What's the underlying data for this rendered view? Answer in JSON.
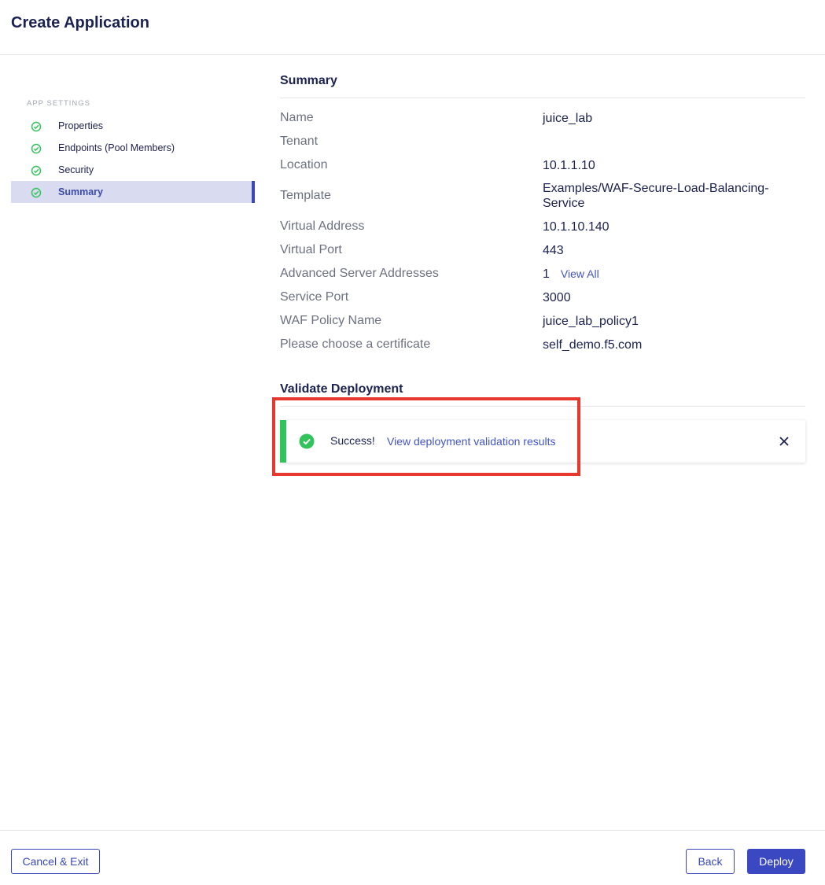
{
  "header": {
    "title": "Create Application"
  },
  "sidebar": {
    "section_label": "APP SETTINGS",
    "items": [
      {
        "label": "Properties",
        "status": "complete"
      },
      {
        "label": "Endpoints (Pool Members)",
        "status": "complete"
      },
      {
        "label": "Security",
        "status": "complete"
      },
      {
        "label": "Summary",
        "status": "complete",
        "active": true
      }
    ]
  },
  "summary": {
    "title": "Summary",
    "rows": [
      {
        "key": "Name",
        "value": "juice_lab"
      },
      {
        "key": "Tenant",
        "value": ""
      },
      {
        "key": "Location",
        "value": "10.1.1.10"
      },
      {
        "key": "Template",
        "value": "Examples/WAF-Secure-Load-Balancing-Service"
      },
      {
        "key": "Virtual Address",
        "value": "10.1.10.140"
      },
      {
        "key": "Virtual Port",
        "value": "443"
      },
      {
        "key": "Advanced Server Addresses",
        "value": "1",
        "link": "View All"
      },
      {
        "key": "Service Port",
        "value": "3000"
      },
      {
        "key": "WAF Policy Name",
        "value": "juice_lab_policy1"
      },
      {
        "key": "Please choose a certificate",
        "value": "self_demo.f5.com"
      }
    ]
  },
  "validate": {
    "title": "Validate Deployment",
    "toast": {
      "message": "Success!",
      "link": "View deployment validation results"
    }
  },
  "footer": {
    "cancel_label": "Cancel & Exit",
    "back_label": "Back",
    "deploy_label": "Deploy"
  },
  "colors": {
    "accent": "#3a48b8",
    "success": "#33c35c",
    "highlight": "#e8372d"
  }
}
